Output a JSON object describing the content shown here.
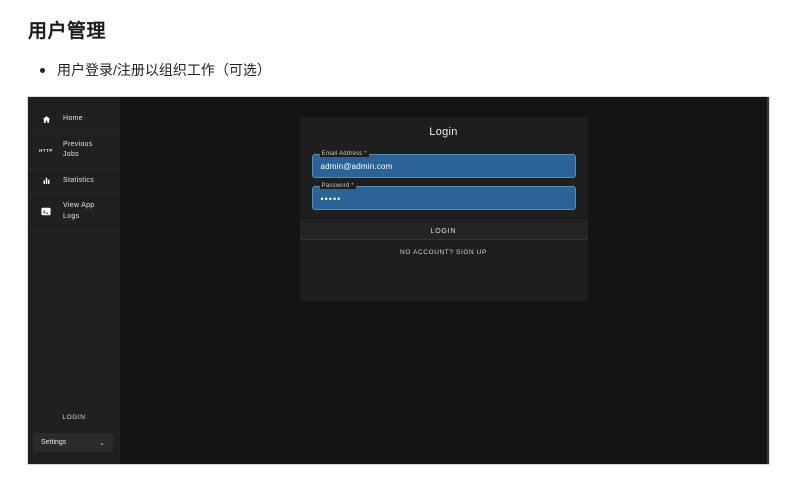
{
  "page": {
    "title": "用户管理",
    "bullet": "用户登录/注册以组织工作（可选）"
  },
  "app": {
    "sidebar": {
      "items": [
        {
          "label": "Home",
          "icon": "home-icon"
        },
        {
          "label": "Previous Jobs",
          "icon": "previous-jobs-icon",
          "glyph": "HTTP"
        },
        {
          "label": "Statistics",
          "icon": "statistics-icon"
        },
        {
          "label": "View App Logs",
          "icon": "terminal-icon"
        }
      ],
      "login_label": "LOGIN",
      "settings": {
        "label": "Settings",
        "chevron": "⌄"
      }
    },
    "login_card": {
      "title": "Login",
      "email": {
        "label": "Email Address *",
        "value": "admin@admin.com"
      },
      "password": {
        "label": "Password *",
        "value": "•••••"
      },
      "login_button": "LOGIN",
      "signup_link": "NO ACCOUNT? SIGN UP"
    },
    "colors": {
      "page_bg": "#ffffff",
      "app_bg": "#141414",
      "sidebar_bg": "#202020",
      "card_bg": "#1e1e1e",
      "field_fill": "#2a6496",
      "field_border": "#5a8cb8"
    }
  }
}
